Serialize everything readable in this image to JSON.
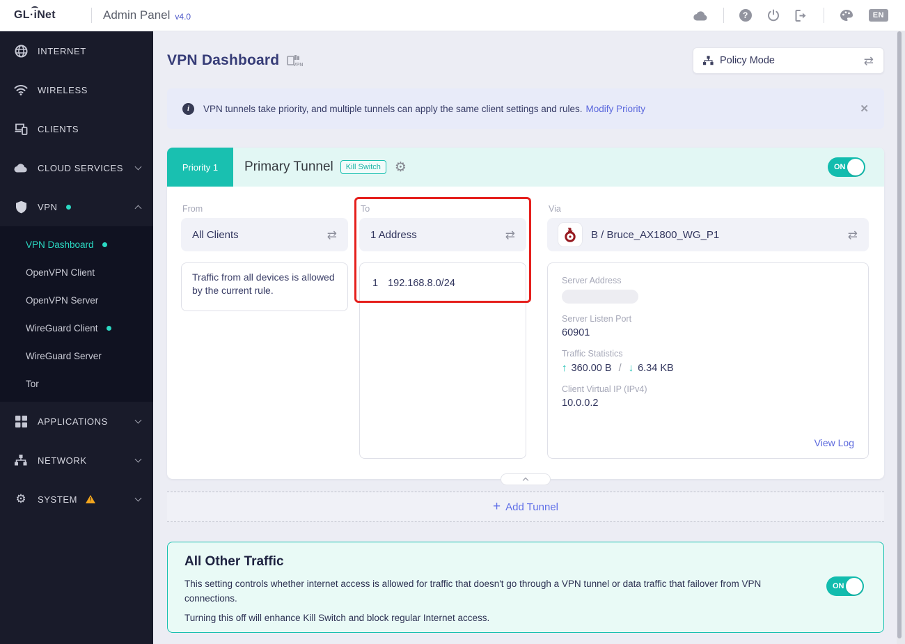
{
  "topbar": {
    "logo_gl": "GL·",
    "logo_i": "i",
    "logo_net": "Net",
    "title": "Admin Panel",
    "version": "v4.0",
    "language": "EN"
  },
  "sidebar": {
    "items": [
      {
        "label": "INTERNET",
        "icon": "globe-icon"
      },
      {
        "label": "WIRELESS",
        "icon": "wifi-icon"
      },
      {
        "label": "CLIENTS",
        "icon": "devices-icon"
      },
      {
        "label": "CLOUD SERVICES",
        "icon": "cloud-icon",
        "chevron": "down"
      },
      {
        "label": "VPN",
        "icon": "shield-icon",
        "chevron": "up",
        "active_dot": true
      },
      {
        "label": "APPLICATIONS",
        "icon": "grid-icon",
        "chevron": "down"
      },
      {
        "label": "NETWORK",
        "icon": "sitemap-icon",
        "chevron": "down"
      },
      {
        "label": "SYSTEM",
        "icon": "gear-icon",
        "chevron": "down",
        "warning": true
      }
    ],
    "vpn_submenu": [
      {
        "label": "VPN Dashboard",
        "active": true,
        "dot": true
      },
      {
        "label": "OpenVPN Client"
      },
      {
        "label": "OpenVPN Server"
      },
      {
        "label": "WireGuard Client",
        "dot": true
      },
      {
        "label": "WireGuard Server"
      },
      {
        "label": "Tor"
      }
    ]
  },
  "page": {
    "title": "VPN Dashboard",
    "mode_label": "Policy Mode"
  },
  "banner": {
    "text": "VPN tunnels take priority, and multiple tunnels can apply the same client settings and rules.",
    "link": "Modify Priority",
    "close": "✕"
  },
  "tunnel": {
    "priority": "Priority 1",
    "name": "Primary Tunnel",
    "kill_switch": "Kill Switch",
    "toggle": "ON",
    "from": {
      "label": "From",
      "value": "All Clients",
      "description": "Traffic from all devices is allowed by the current rule."
    },
    "to": {
      "label": "To",
      "value": "1 Address",
      "item_index": "1",
      "item_value": "192.168.8.0/24"
    },
    "via": {
      "label": "Via",
      "value": "B / Bruce_AX1800_WG_P1",
      "server_address_label": "Server Address",
      "listen_port_label": "Server Listen Port",
      "listen_port": "60901",
      "traffic_label": "Traffic Statistics",
      "upload_arrow": "↑",
      "upload": "360.00 B",
      "separator": "/",
      "download_arrow": "↓",
      "download": "6.34 KB",
      "client_ip_label": "Client Virtual IP (IPv4)",
      "client_ip": "10.0.0.2",
      "view_log": "View Log"
    }
  },
  "add_tunnel": {
    "plus": "+",
    "label": "Add Tunnel"
  },
  "other_traffic": {
    "title": "All Other Traffic",
    "line1": "This setting controls whether internet access is allowed for traffic that doesn't go through a VPN tunnel or data traffic that failover from VPN connections.",
    "line2": "Turning this off will enhance Kill Switch and block regular Internet access.",
    "toggle": "ON"
  },
  "icon_glyphs": {
    "swap-icon": "⇄",
    "gear-icon": "⚙",
    "close-icon": "✕",
    "help-icon": "?",
    "info-icon": "i",
    "warning-icon": "⚠ (orange triangle)",
    "language-badge": "EN"
  },
  "colors": {
    "teal_accent": "#12bcae",
    "teal_dot": "#2bd9c3",
    "sidebar_bg": "#191b2a",
    "submenu_bg": "#101221",
    "page_bg": "#ecedf4",
    "banner_bg": "#e8ebf9",
    "tunnel_header_bg": "#e2f7f4",
    "aot_bg": "#e9faf6",
    "link_blue": "#5b68dd",
    "title_indigo": "#363c77",
    "text_dark": "#32365e",
    "label_gray": "#a6a8b8",
    "annotation_red": "#e5201d",
    "warning_orange": "#f2a51d",
    "wireguard_red": "#96191f"
  }
}
